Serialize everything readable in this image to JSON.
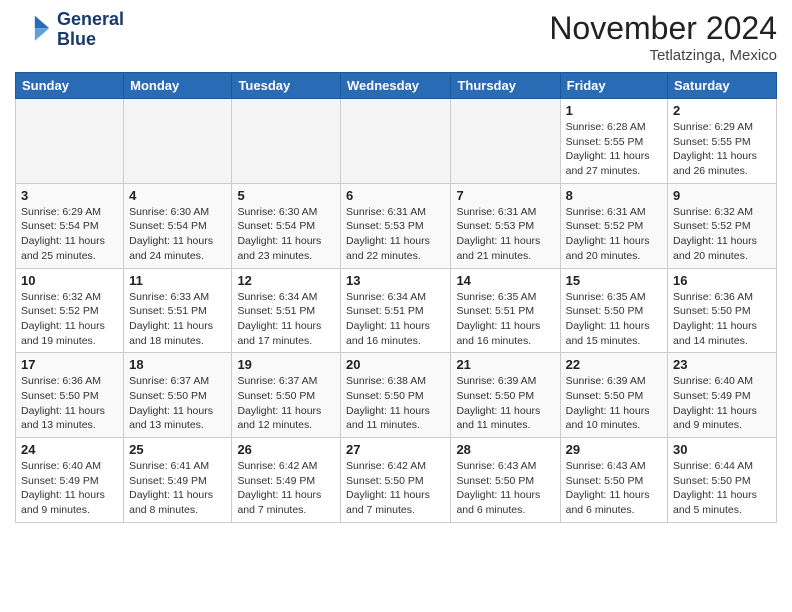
{
  "header": {
    "logo_line1": "General",
    "logo_line2": "Blue",
    "month": "November 2024",
    "location": "Tetlatzinga, Mexico"
  },
  "weekdays": [
    "Sunday",
    "Monday",
    "Tuesday",
    "Wednesday",
    "Thursday",
    "Friday",
    "Saturday"
  ],
  "weeks": [
    [
      {
        "day": "",
        "info": ""
      },
      {
        "day": "",
        "info": ""
      },
      {
        "day": "",
        "info": ""
      },
      {
        "day": "",
        "info": ""
      },
      {
        "day": "",
        "info": ""
      },
      {
        "day": "1",
        "info": "Sunrise: 6:28 AM\nSunset: 5:55 PM\nDaylight: 11 hours and 27 minutes."
      },
      {
        "day": "2",
        "info": "Sunrise: 6:29 AM\nSunset: 5:55 PM\nDaylight: 11 hours and 26 minutes."
      }
    ],
    [
      {
        "day": "3",
        "info": "Sunrise: 6:29 AM\nSunset: 5:54 PM\nDaylight: 11 hours and 25 minutes."
      },
      {
        "day": "4",
        "info": "Sunrise: 6:30 AM\nSunset: 5:54 PM\nDaylight: 11 hours and 24 minutes."
      },
      {
        "day": "5",
        "info": "Sunrise: 6:30 AM\nSunset: 5:54 PM\nDaylight: 11 hours and 23 minutes."
      },
      {
        "day": "6",
        "info": "Sunrise: 6:31 AM\nSunset: 5:53 PM\nDaylight: 11 hours and 22 minutes."
      },
      {
        "day": "7",
        "info": "Sunrise: 6:31 AM\nSunset: 5:53 PM\nDaylight: 11 hours and 21 minutes."
      },
      {
        "day": "8",
        "info": "Sunrise: 6:31 AM\nSunset: 5:52 PM\nDaylight: 11 hours and 20 minutes."
      },
      {
        "day": "9",
        "info": "Sunrise: 6:32 AM\nSunset: 5:52 PM\nDaylight: 11 hours and 20 minutes."
      }
    ],
    [
      {
        "day": "10",
        "info": "Sunrise: 6:32 AM\nSunset: 5:52 PM\nDaylight: 11 hours and 19 minutes."
      },
      {
        "day": "11",
        "info": "Sunrise: 6:33 AM\nSunset: 5:51 PM\nDaylight: 11 hours and 18 minutes."
      },
      {
        "day": "12",
        "info": "Sunrise: 6:34 AM\nSunset: 5:51 PM\nDaylight: 11 hours and 17 minutes."
      },
      {
        "day": "13",
        "info": "Sunrise: 6:34 AM\nSunset: 5:51 PM\nDaylight: 11 hours and 16 minutes."
      },
      {
        "day": "14",
        "info": "Sunrise: 6:35 AM\nSunset: 5:51 PM\nDaylight: 11 hours and 16 minutes."
      },
      {
        "day": "15",
        "info": "Sunrise: 6:35 AM\nSunset: 5:50 PM\nDaylight: 11 hours and 15 minutes."
      },
      {
        "day": "16",
        "info": "Sunrise: 6:36 AM\nSunset: 5:50 PM\nDaylight: 11 hours and 14 minutes."
      }
    ],
    [
      {
        "day": "17",
        "info": "Sunrise: 6:36 AM\nSunset: 5:50 PM\nDaylight: 11 hours and 13 minutes."
      },
      {
        "day": "18",
        "info": "Sunrise: 6:37 AM\nSunset: 5:50 PM\nDaylight: 11 hours and 13 minutes."
      },
      {
        "day": "19",
        "info": "Sunrise: 6:37 AM\nSunset: 5:50 PM\nDaylight: 11 hours and 12 minutes."
      },
      {
        "day": "20",
        "info": "Sunrise: 6:38 AM\nSunset: 5:50 PM\nDaylight: 11 hours and 11 minutes."
      },
      {
        "day": "21",
        "info": "Sunrise: 6:39 AM\nSunset: 5:50 PM\nDaylight: 11 hours and 11 minutes."
      },
      {
        "day": "22",
        "info": "Sunrise: 6:39 AM\nSunset: 5:50 PM\nDaylight: 11 hours and 10 minutes."
      },
      {
        "day": "23",
        "info": "Sunrise: 6:40 AM\nSunset: 5:49 PM\nDaylight: 11 hours and 9 minutes."
      }
    ],
    [
      {
        "day": "24",
        "info": "Sunrise: 6:40 AM\nSunset: 5:49 PM\nDaylight: 11 hours and 9 minutes."
      },
      {
        "day": "25",
        "info": "Sunrise: 6:41 AM\nSunset: 5:49 PM\nDaylight: 11 hours and 8 minutes."
      },
      {
        "day": "26",
        "info": "Sunrise: 6:42 AM\nSunset: 5:49 PM\nDaylight: 11 hours and 7 minutes."
      },
      {
        "day": "27",
        "info": "Sunrise: 6:42 AM\nSunset: 5:50 PM\nDaylight: 11 hours and 7 minutes."
      },
      {
        "day": "28",
        "info": "Sunrise: 6:43 AM\nSunset: 5:50 PM\nDaylight: 11 hours and 6 minutes."
      },
      {
        "day": "29",
        "info": "Sunrise: 6:43 AM\nSunset: 5:50 PM\nDaylight: 11 hours and 6 minutes."
      },
      {
        "day": "30",
        "info": "Sunrise: 6:44 AM\nSunset: 5:50 PM\nDaylight: 11 hours and 5 minutes."
      }
    ]
  ]
}
